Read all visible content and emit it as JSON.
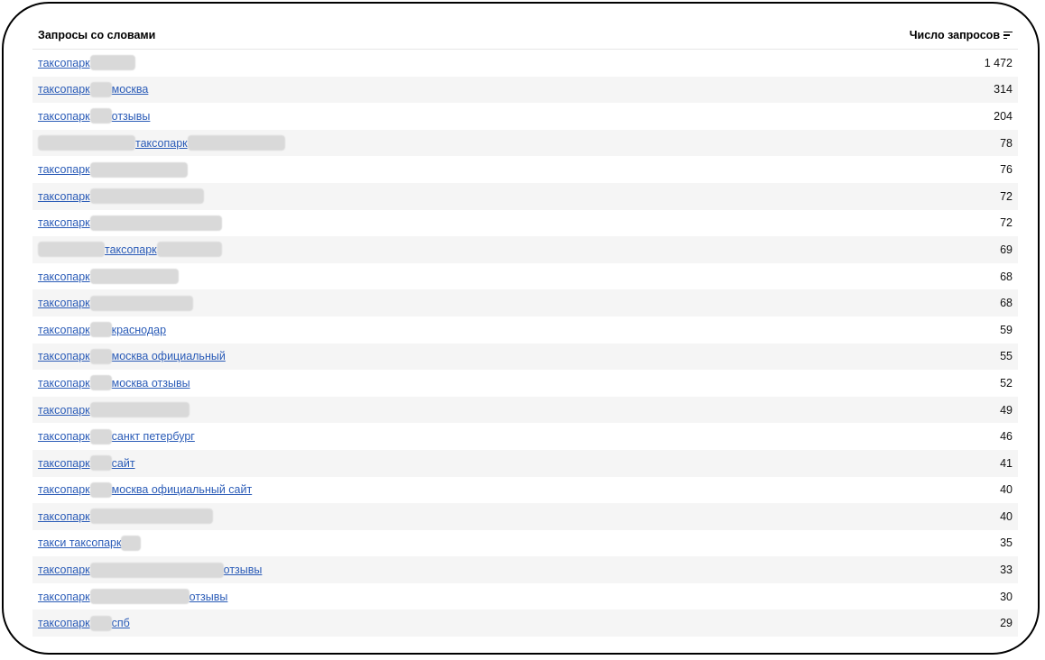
{
  "header": {
    "query_col": "Запросы со словами",
    "count_col": "Число запросов"
  },
  "rows": [
    {
      "query": [
        {
          "t": "таксопарк"
        },
        {
          "b": 50
        }
      ],
      "count": "1 472"
    },
    {
      "query": [
        {
          "t": "таксопарк"
        },
        {
          "b": 24
        },
        {
          "t": "москва"
        }
      ],
      "count": "314"
    },
    {
      "query": [
        {
          "t": "таксопарк"
        },
        {
          "b": 24
        },
        {
          "t": "отзывы"
        }
      ],
      "count": "204"
    },
    {
      "query": [
        {
          "b": 108
        },
        {
          "t": "таксопарк"
        },
        {
          "b": 108
        }
      ],
      "count": "78"
    },
    {
      "query": [
        {
          "t": "таксопарк"
        },
        {
          "b": 108
        }
      ],
      "count": "76"
    },
    {
      "query": [
        {
          "t": "таксопарк"
        },
        {
          "b": 126
        }
      ],
      "count": "72"
    },
    {
      "query": [
        {
          "t": "таксопарк"
        },
        {
          "b": 146
        }
      ],
      "count": "72"
    },
    {
      "query": [
        {
          "b": 74
        },
        {
          "t": "таксопарк"
        },
        {
          "b": 72
        }
      ],
      "count": "69"
    },
    {
      "query": [
        {
          "t": "таксопарк"
        },
        {
          "b": 98
        }
      ],
      "count": "68"
    },
    {
      "query": [
        {
          "t": "таксопарк"
        },
        {
          "b": 114
        }
      ],
      "count": "68"
    },
    {
      "query": [
        {
          "t": "таксопарк"
        },
        {
          "b": 24
        },
        {
          "t": "краснодар"
        }
      ],
      "count": "59"
    },
    {
      "query": [
        {
          "t": "таксопарк"
        },
        {
          "b": 24
        },
        {
          "t": "москва официальный"
        }
      ],
      "count": "55"
    },
    {
      "query": [
        {
          "t": "таксопарк"
        },
        {
          "b": 24
        },
        {
          "t": "москва отзывы"
        }
      ],
      "count": "52"
    },
    {
      "query": [
        {
          "t": "таксопарк"
        },
        {
          "b": 110
        }
      ],
      "count": "49"
    },
    {
      "query": [
        {
          "t": "таксопарк"
        },
        {
          "b": 24
        },
        {
          "t": "санкт петербург"
        }
      ],
      "count": "46"
    },
    {
      "query": [
        {
          "t": "таксопарк"
        },
        {
          "b": 24
        },
        {
          "t": "сайт"
        }
      ],
      "count": "41"
    },
    {
      "query": [
        {
          "t": "таксопарк"
        },
        {
          "b": 24
        },
        {
          "t": "москва официальный сайт"
        }
      ],
      "count": "40"
    },
    {
      "query": [
        {
          "t": "таксопарк"
        },
        {
          "b": 136
        }
      ],
      "count": "40"
    },
    {
      "query": [
        {
          "t": "такси таксопарк"
        },
        {
          "b": 22
        }
      ],
      "count": "35"
    },
    {
      "query": [
        {
          "t": "таксопарк"
        },
        {
          "b": 148
        },
        {
          "t": "отзывы"
        }
      ],
      "count": "33"
    },
    {
      "query": [
        {
          "t": "таксопарк"
        },
        {
          "b": 110
        },
        {
          "t": "отзывы"
        }
      ],
      "count": "30"
    },
    {
      "query": [
        {
          "t": "таксопарк"
        },
        {
          "b": 24
        },
        {
          "t": "спб"
        }
      ],
      "count": "29"
    }
  ]
}
